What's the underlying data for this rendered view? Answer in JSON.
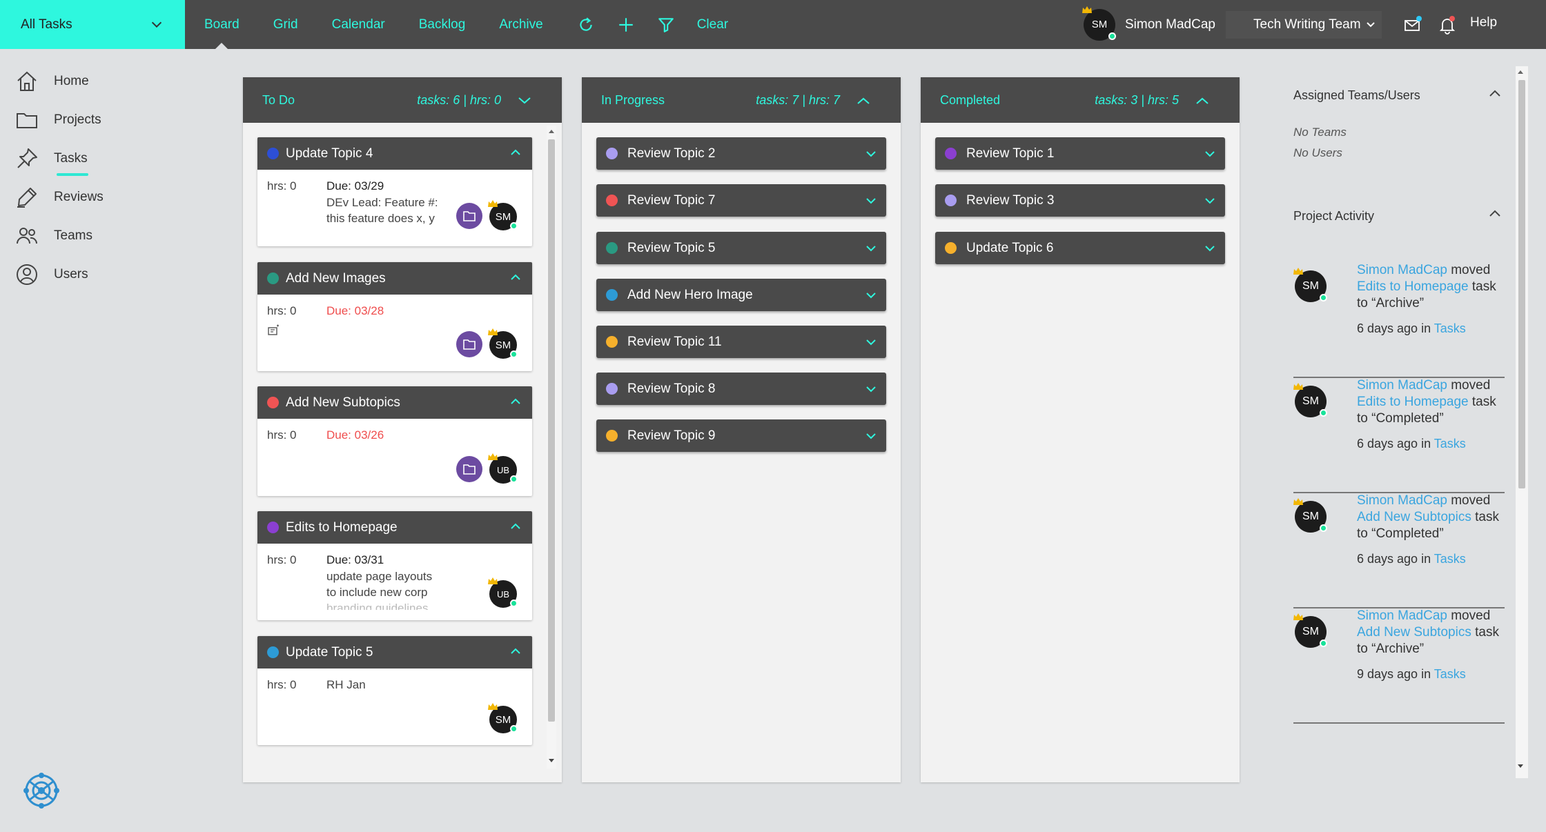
{
  "header": {
    "view_selector": "All Tasks",
    "nav": [
      "Board",
      "Grid",
      "Calendar",
      "Backlog",
      "Archive"
    ],
    "clear_label": "Clear",
    "user_initials": "SM",
    "user_name": "Simon MadCap",
    "team": "Tech Writing Team",
    "help": "Help"
  },
  "sidebar": {
    "items": [
      {
        "label": "Home",
        "icon": "home-icon"
      },
      {
        "label": "Projects",
        "icon": "folder-icon"
      },
      {
        "label": "Tasks",
        "icon": "pin-icon"
      },
      {
        "label": "Reviews",
        "icon": "pen-icon"
      },
      {
        "label": "Teams",
        "icon": "team-icon"
      },
      {
        "label": "Users",
        "icon": "user-icon"
      }
    ],
    "active": "Tasks"
  },
  "columns": [
    {
      "title": "To Do",
      "stats": "tasks: 6 | hrs: 0",
      "cards": [
        {
          "name": "Update Topic 4",
          "color": "#2d4fd6",
          "hrs": "hrs: 0",
          "due": "Due: 03/29",
          "due_late": false,
          "desc": [
            "DEv Lead: Feature #:",
            "this feature does x, y"
          ],
          "folder": true,
          "assignee": "SM"
        },
        {
          "name": "Add New Images",
          "color": "#2a9a82",
          "hrs": "hrs: 0",
          "due": "Due: 03/28",
          "due_late": true,
          "desc": [],
          "folder": true,
          "assignee": "SM",
          "attachment": true
        },
        {
          "name": "Add New Subtopics",
          "color": "#f05454",
          "hrs": "hrs: 0",
          "due": "Due: 03/26",
          "due_late": true,
          "desc": [],
          "folder": true,
          "assignee": "UB"
        },
        {
          "name": "Edits to Homepage",
          "color": "#8b3fd1",
          "hrs": "hrs: 0",
          "due": "Due: 03/31",
          "due_late": false,
          "desc": [
            "update page layouts",
            "to include new corp",
            "branding guidelines"
          ],
          "folder": false,
          "assignee": "UB"
        },
        {
          "name": "Update Topic 5",
          "color": "#2d9bd6",
          "hrs": "hrs: 0",
          "due": "RH Jan",
          "due_late": false,
          "desc": [],
          "folder": false,
          "assignee": "SM"
        }
      ]
    },
    {
      "title": "In Progress",
      "stats": "tasks: 7 | hrs: 7",
      "tasks": [
        {
          "name": "Review Topic 2",
          "color": "#a99df0"
        },
        {
          "name": "Review Topic 7",
          "color": "#f05454"
        },
        {
          "name": "Review Topic 5",
          "color": "#2a9a82"
        },
        {
          "name": "Add New Hero Image",
          "color": "#2d9bd6"
        },
        {
          "name": "Review Topic 11",
          "color": "#f6b02c"
        },
        {
          "name": "Review Topic 8",
          "color": "#a99df0"
        },
        {
          "name": "Review Topic 9",
          "color": "#f6b02c"
        }
      ]
    },
    {
      "title": "Completed",
      "stats": "tasks: 3 | hrs: 5",
      "tasks": [
        {
          "name": "Review Topic 1",
          "color": "#8b3fd1"
        },
        {
          "name": "Review Topic 3",
          "color": "#a99df0"
        },
        {
          "name": "Update Topic 6",
          "color": "#f6b02c"
        }
      ]
    }
  ],
  "right_panel": {
    "assigned_title": "Assigned Teams/Users",
    "no_teams": "No Teams",
    "no_users": "No Users",
    "activity_title": "Project Activity",
    "activities": [
      {
        "user": "Simon MadCap",
        "verb": "moved",
        "task": "Edits to Homepage",
        "tail": "task to “Archive”",
        "time": "6 days ago in",
        "where": "Tasks"
      },
      {
        "user": "Simon MadCap",
        "verb": "moved",
        "task": "Edits to Homepage",
        "tail": "task to “Completed”",
        "time": "6 days ago in",
        "where": "Tasks"
      },
      {
        "user": "Simon MadCap",
        "verb": "moved",
        "task": "Add New Subtopics",
        "tail": "task to “Completed”",
        "time": "6 days ago in",
        "where": "Tasks"
      },
      {
        "user": "Simon MadCap",
        "verb": "moved",
        "task": "Add New Subtopics",
        "tail": "task to “Archive”",
        "time": "9 days ago in",
        "where": "Tasks"
      }
    ]
  },
  "colors": {
    "accent": "#2ef7de",
    "topbar": "#4a4a4a",
    "link": "#3aa5df",
    "late": "#ef4d4d",
    "online": "#19e39a",
    "folder": "#6c4ba1"
  }
}
